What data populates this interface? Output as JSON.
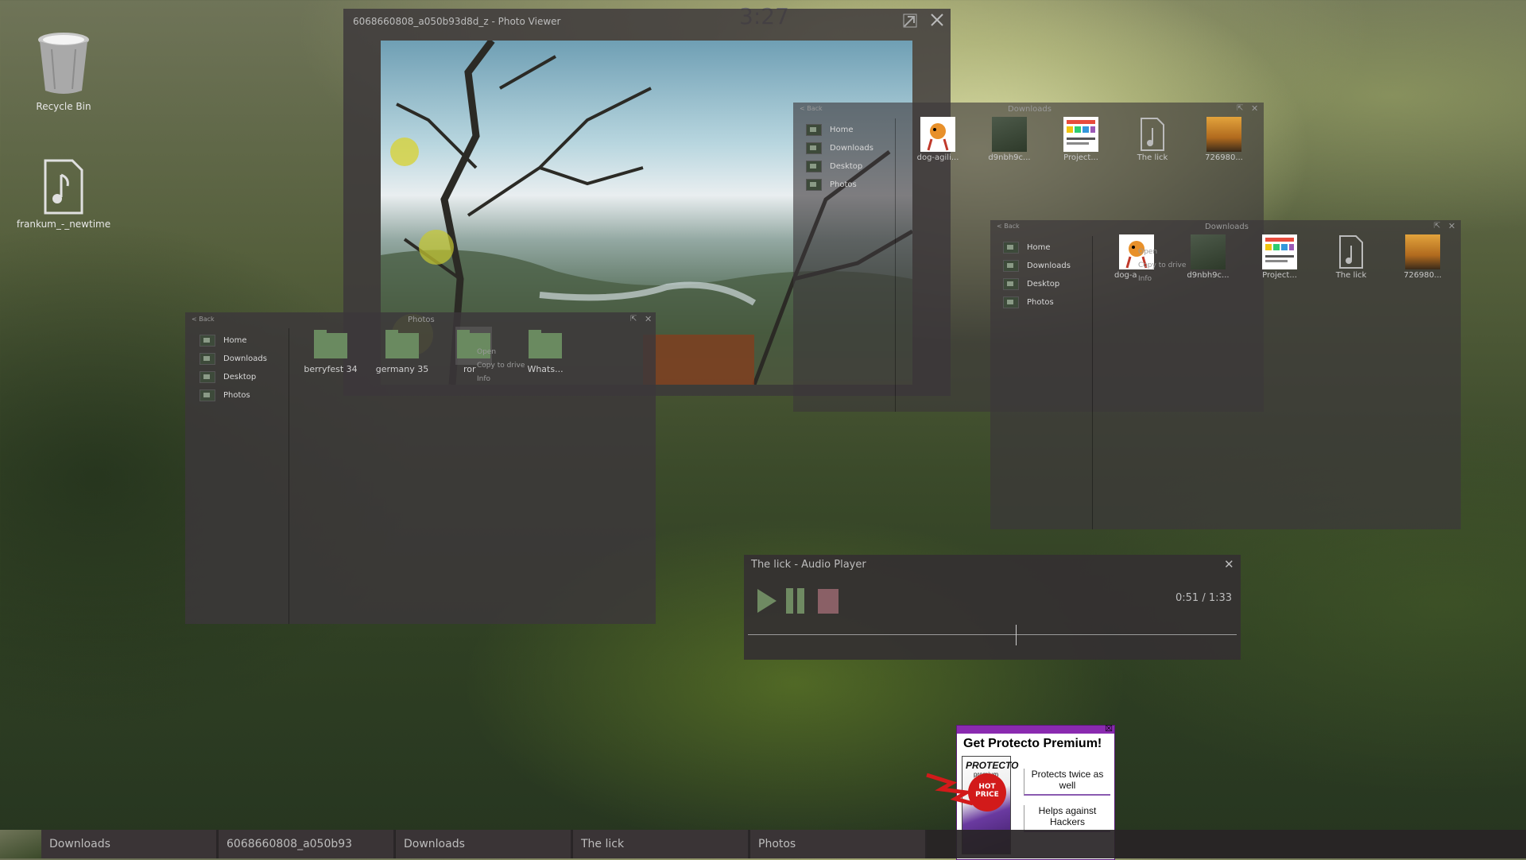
{
  "clock": "3:27",
  "desktop": {
    "icons": [
      {
        "label": "Recycle Bin",
        "icon": "trash-icon"
      },
      {
        "label": "frankum_-_newtime",
        "icon": "music-file-icon"
      }
    ]
  },
  "photo_viewer": {
    "title": "6068660808_a050b93d8d_z - Photo Viewer"
  },
  "photos_window": {
    "back": "< Back",
    "title": "Photos",
    "nav": [
      "Home",
      "Downloads",
      "Desktop",
      "Photos"
    ],
    "items": [
      {
        "label": "berryfest 34"
      },
      {
        "label": "germany 35"
      },
      {
        "label": "ror"
      },
      {
        "label": "Whats..."
      }
    ],
    "context_menu": [
      "Open",
      "Copy to drive",
      "Info"
    ]
  },
  "downloads_window_1": {
    "back": "< Back",
    "title": "Downloads",
    "nav": [
      "Home",
      "Downloads",
      "Desktop",
      "Photos"
    ],
    "items": [
      "dog-agili...",
      "d9nbh9c...",
      "Project...",
      "The lick",
      "726980..."
    ]
  },
  "downloads_window_2": {
    "back": "< Back",
    "title": "Downloads",
    "nav": [
      "Home",
      "Downloads",
      "Desktop",
      "Photos"
    ],
    "items": [
      "dog-a",
      "d9nbh9c...",
      "Project...",
      "The lick",
      "726980..."
    ],
    "context_menu": [
      "Open",
      "Copy to drive",
      "Info"
    ]
  },
  "audio_player": {
    "title": "The lick - Audio Player",
    "time": "0:51 / 1:33",
    "progress": 0.548
  },
  "ad": {
    "headline": "Get Protecto Premium!",
    "brand": "PROTECTO",
    "brand_sub": "premium",
    "badge": "HOT PRICE",
    "line1": "Protects twice as well",
    "line2": "Helps against Hackers"
  },
  "taskbar": {
    "items": [
      "Downloads",
      "6068660808_a050b93",
      "Downloads",
      "The lick",
      "Photos"
    ]
  }
}
